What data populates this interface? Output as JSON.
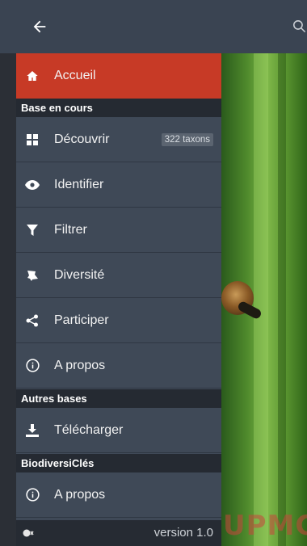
{
  "appbar": {
    "back_icon": "arrow-left-icon",
    "search_icon": "search-icon"
  },
  "drawer": {
    "home": {
      "label": "Accueil",
      "icon": "home-icon"
    },
    "section_current": "Base en cours",
    "items_current": [
      {
        "label": "Découvrir",
        "icon": "grid-icon",
        "badge": "322 taxons"
      },
      {
        "label": "Identifier",
        "icon": "eye-icon"
      },
      {
        "label": "Filtrer",
        "icon": "filter-icon"
      },
      {
        "label": "Diversité",
        "icon": "bug-icon"
      },
      {
        "label": "Participer",
        "icon": "share-icon"
      },
      {
        "label": "A propos",
        "icon": "info-icon"
      }
    ],
    "section_other": "Autres bases",
    "items_other": [
      {
        "label": "Télécharger",
        "icon": "download-icon"
      }
    ],
    "section_app": "BiodiversiClés",
    "items_app": [
      {
        "label": "A propos",
        "icon": "info-icon"
      }
    ],
    "footer": {
      "version": "version 1.0",
      "icon": "key-icon"
    }
  },
  "photo": {
    "logo_text": "UPMC"
  },
  "colors": {
    "active": "#c73a26",
    "drawer_bg": "#3f4957",
    "appbar": "#3a4452",
    "section": "#252a32"
  }
}
